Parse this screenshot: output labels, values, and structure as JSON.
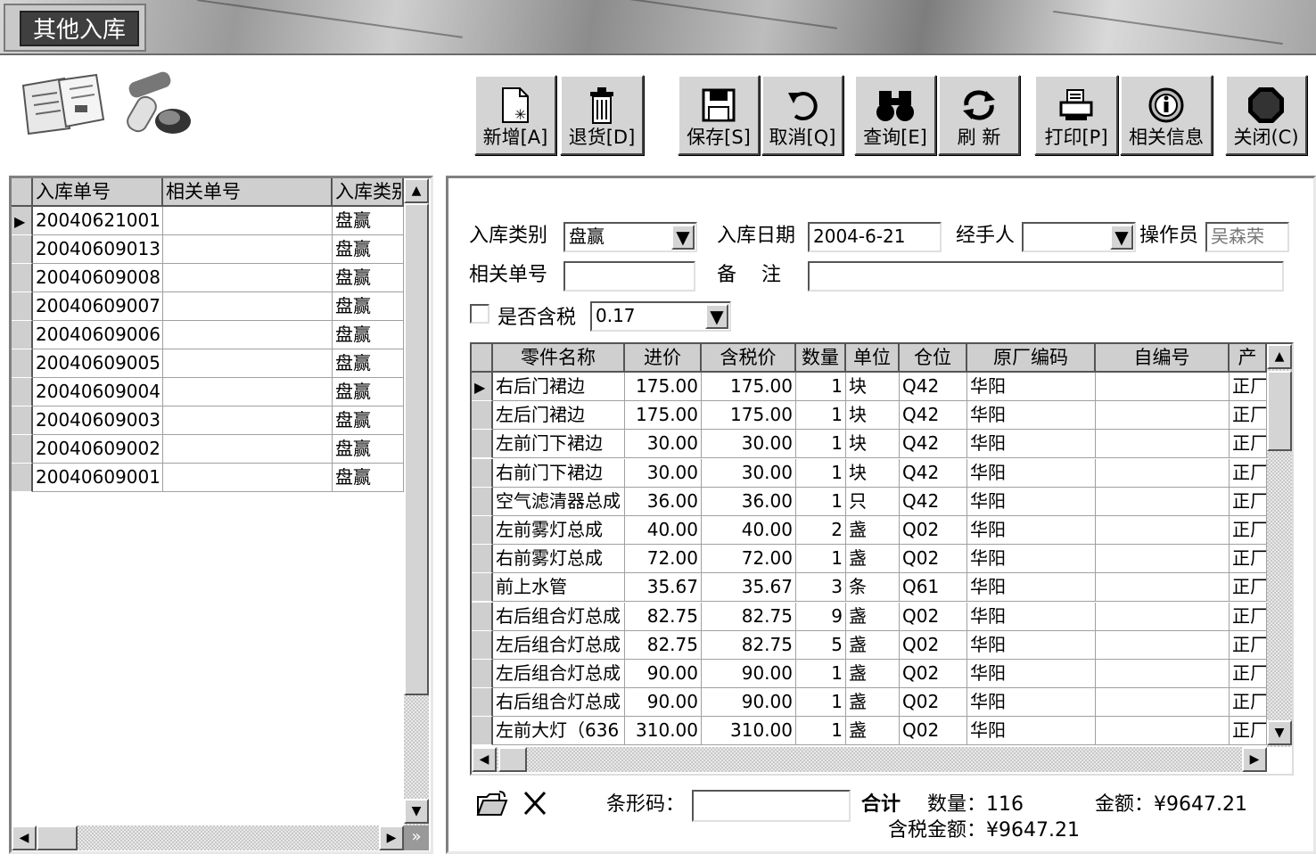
{
  "window": {
    "title": "其他入库"
  },
  "toolbar": {
    "buttons": [
      {
        "label": "新增[A]",
        "icon": "new-document-icon"
      },
      {
        "label": "退货[D]",
        "icon": "trash-icon"
      },
      {
        "label": "保存[S]",
        "icon": "floppy-disk-icon"
      },
      {
        "label": "取消[Q]",
        "icon": "undo-icon"
      },
      {
        "label": "查询[E]",
        "icon": "binoculars-icon"
      },
      {
        "label": "刷 新",
        "icon": "refresh-icon"
      },
      {
        "label": "打印[P]",
        "icon": "printer-icon"
      },
      {
        "label": "相关信息",
        "icon": "info-icon"
      },
      {
        "label": "关闭(C)",
        "icon": "stop-icon"
      }
    ]
  },
  "left_grid": {
    "headers": [
      "入库单号",
      "相关单号",
      "入库类别"
    ],
    "rows": [
      {
        "no": "20040621001",
        "rel": "",
        "type": "盘赢"
      },
      {
        "no": "20040609013",
        "rel": "",
        "type": "盘赢"
      },
      {
        "no": "20040609008",
        "rel": "",
        "type": "盘赢"
      },
      {
        "no": "20040609007",
        "rel": "",
        "type": "盘赢"
      },
      {
        "no": "20040609006",
        "rel": "",
        "type": "盘赢"
      },
      {
        "no": "20040609005",
        "rel": "",
        "type": "盘赢"
      },
      {
        "no": "20040609004",
        "rel": "",
        "type": "盘赢"
      },
      {
        "no": "20040609003",
        "rel": "",
        "type": "盘赢"
      },
      {
        "no": "20040609002",
        "rel": "",
        "type": "盘赢"
      },
      {
        "no": "20040609001",
        "rel": "",
        "type": "盘赢"
      }
    ]
  },
  "form": {
    "category_label": "入库类别",
    "category_value": "盘赢",
    "date_label": "入库日期",
    "date_value": "2004-6-21",
    "handler_label": "经手人",
    "handler_value": "",
    "operator_label": "操作员",
    "operator_value": "吴森荣",
    "related_label": "相关单号",
    "related_value": "",
    "remark_label": "备    注",
    "remark_value": "",
    "tax_label": "是否含税",
    "tax_checked": false,
    "tax_rate": "0.17"
  },
  "parts_grid": {
    "headers": [
      "零件名称",
      "进价",
      "含税价",
      "数量",
      "单位",
      "仓位",
      "原厂编码",
      "自编号",
      "产"
    ],
    "rows": [
      [
        "右后门裙边",
        "175.00",
        "175.00",
        "1",
        "块",
        "Q42",
        "华阳",
        "",
        "正厂"
      ],
      [
        "左后门裙边",
        "175.00",
        "175.00",
        "1",
        "块",
        "Q42",
        "华阳",
        "",
        "正厂"
      ],
      [
        "左前门下裙边",
        "30.00",
        "30.00",
        "1",
        "块",
        "Q42",
        "华阳",
        "",
        "正厂"
      ],
      [
        "右前门下裙边",
        "30.00",
        "30.00",
        "1",
        "块",
        "Q42",
        "华阳",
        "",
        "正厂"
      ],
      [
        "空气滤清器总成",
        "36.00",
        "36.00",
        "1",
        "只",
        "Q42",
        "华阳",
        "",
        "正厂"
      ],
      [
        "左前雾灯总成",
        "40.00",
        "40.00",
        "2",
        "盏",
        "Q02",
        "华阳",
        "",
        "正厂"
      ],
      [
        "右前雾灯总成",
        "72.00",
        "72.00",
        "1",
        "盏",
        "Q02",
        "华阳",
        "",
        "正厂"
      ],
      [
        "前上水管",
        "35.67",
        "35.67",
        "3",
        "条",
        "Q61",
        "华阳",
        "",
        "正厂"
      ],
      [
        "右后组合灯总成",
        "82.75",
        "82.75",
        "9",
        "盏",
        "Q02",
        "华阳",
        "",
        "正厂"
      ],
      [
        "左后组合灯总成",
        "82.75",
        "82.75",
        "5",
        "盏",
        "Q02",
        "华阳",
        "",
        "正厂"
      ],
      [
        "左后组合灯总成",
        "90.00",
        "90.00",
        "1",
        "盏",
        "Q02",
        "华阳",
        "",
        "正厂"
      ],
      [
        "右后组合灯总成",
        "90.00",
        "90.00",
        "1",
        "盏",
        "Q02",
        "华阳",
        "",
        "正厂"
      ],
      [
        "左前大灯（636",
        "310.00",
        "310.00",
        "1",
        "盏",
        "Q02",
        "华阳",
        "",
        "正厂"
      ]
    ]
  },
  "footer": {
    "barcode_label": "条形码：",
    "barcode_value": "",
    "total_label": "合计",
    "qty_label": "数量：",
    "qty_value": "116",
    "amount_label": "金额：",
    "amount_value": "¥9647.21",
    "tax_amount_label": "含税金额：",
    "tax_amount_value": "¥9647.21"
  }
}
